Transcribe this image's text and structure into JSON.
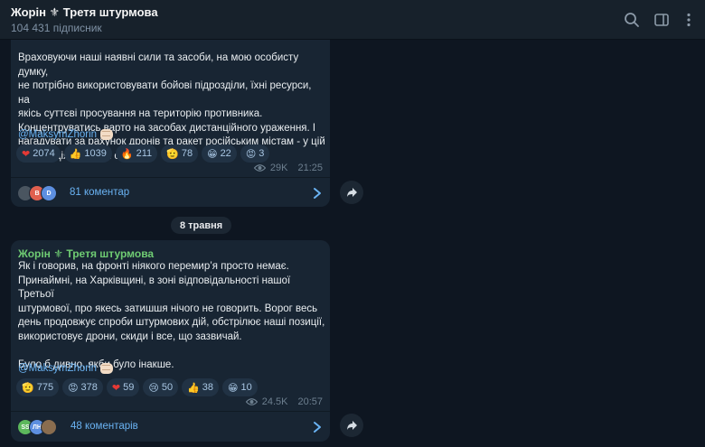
{
  "header": {
    "title": "Жорін ⚜ Третя штурмова",
    "subscribers": "104 431 підписник",
    "icons": [
      "search-icon",
      "sidebar-toggle-icon",
      "more-icon"
    ]
  },
  "colors": {
    "background": "#0e1621",
    "bubble": "#182533",
    "accent_link": "#6ab3f3",
    "author_name": "#6fcc73"
  },
  "messages": [
    {
      "author": "",
      "text": "Враховуючи наші наявні сили та засоби, на мою особисту думку,\nне потрібно використовувати бойові підрозділи, їхні ресурси, на\nякісь суттєві просування на територію противника.\nКонцентруватись варто на засобах дистанційного ураження. І\nнагадувати за рахунок дронів та ракет російським містам - у цій\n«грі» задіяні обидві сторони.",
      "signature": "@MaksymZhorin",
      "reactions": [
        {
          "emoji": "❤",
          "count": "2074"
        },
        {
          "emoji": "👍",
          "count": "1039"
        },
        {
          "emoji": "🔥",
          "count": "211"
        },
        {
          "emoji": "🫡",
          "count": "78"
        },
        {
          "emoji": "😁",
          "count": "22"
        },
        {
          "emoji": "😡",
          "count": "3"
        }
      ],
      "views": "29K",
      "time": "21:25",
      "comments": "81 коментар",
      "avatars": [
        {
          "label": "",
          "color": "#4a5560"
        },
        {
          "label": "B",
          "color": "#e0604f"
        },
        {
          "label": "D",
          "color": "#5d8fe0"
        }
      ]
    },
    {
      "author": "Жорін ⚜ Третя штурмова",
      "text": "Як і говорив, на фронті ніякого перемир’я просто немає.\nПринаймні, на Харківщині, в зоні відповідальності нашої Третьої\nштурмової, про якесь затишшя нічого не говорить. Ворог весь\nдень продовжує спроби штурмових дій, обстрілює наші позиції,\nвикористовує дрони, скиди і все, що зазвичай.\n\nБуло б дивно, якби було інакше.",
      "signature": "@MaksymZhorin",
      "reactions": [
        {
          "emoji": "🫡",
          "count": "775"
        },
        {
          "emoji": "😡",
          "count": "378"
        },
        {
          "emoji": "❤",
          "count": "59"
        },
        {
          "emoji": "😢",
          "count": "50"
        },
        {
          "emoji": "👍",
          "count": "38"
        },
        {
          "emoji": "😁",
          "count": "10"
        }
      ],
      "views": "24.5K",
      "time": "20:57",
      "comments": "48 коментарів",
      "avatars": [
        {
          "label": "SS",
          "color": "#5cb85c"
        },
        {
          "label": "ЛН",
          "color": "#5d8fe0"
        },
        {
          "label": "",
          "color": "#8a6d4f"
        }
      ]
    }
  ],
  "date_separator": "8 травня"
}
